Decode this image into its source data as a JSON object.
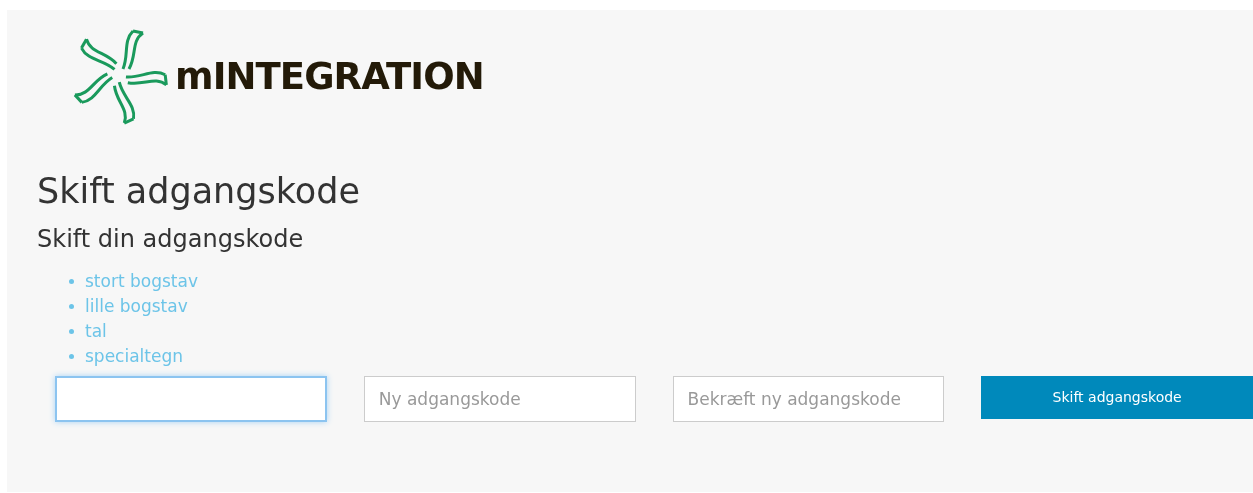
{
  "logo": {
    "text": "mINTEGRATION"
  },
  "title": "Skift adgangskode",
  "subtitle": "Skift din adgangskode",
  "requirements": [
    "stort bogstav",
    "lille bogstav",
    "tal",
    "specialtegn"
  ],
  "fields": [
    {
      "focused": true
    },
    {
      "placeholder": "Ny adgangskode",
      "focused": false
    },
    {
      "placeholder": "Bekræft ny adgangskode",
      "focused": false
    }
  ],
  "button": {
    "label": "Skift adgangskode"
  }
}
